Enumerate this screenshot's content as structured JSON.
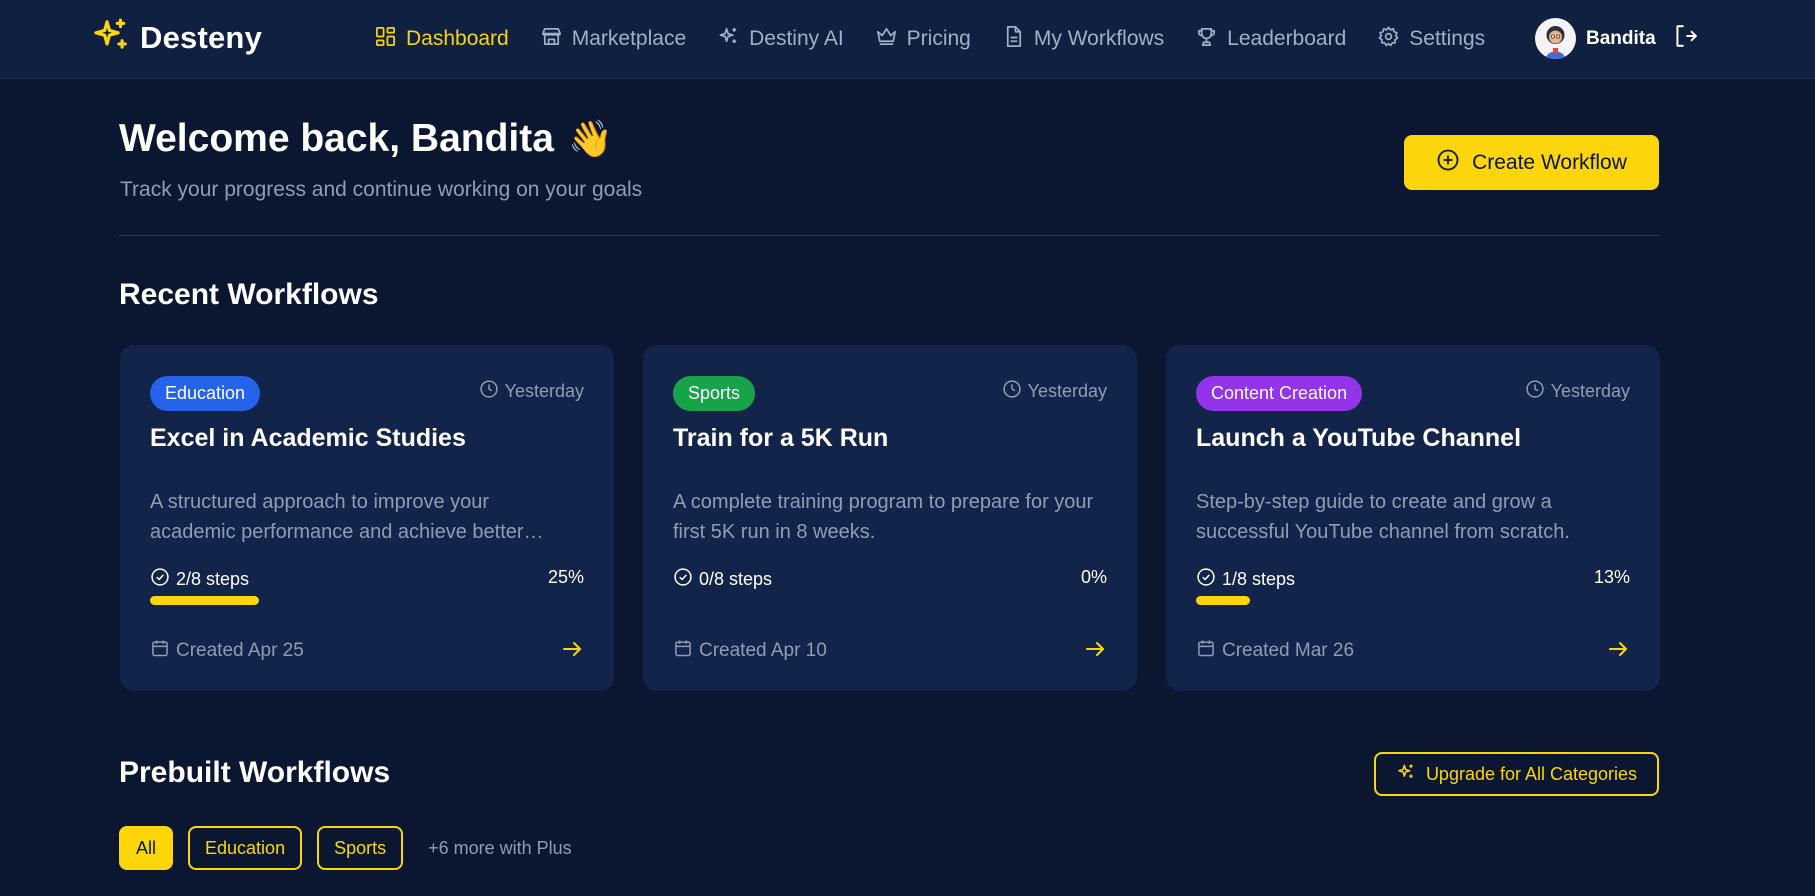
{
  "brand": {
    "name": "Desteny",
    "accent": "#fcd60a"
  },
  "nav": {
    "items": [
      {
        "label": "Dashboard",
        "icon": "grid-icon",
        "active": true
      },
      {
        "label": "Marketplace",
        "icon": "store-icon"
      },
      {
        "label": "Destiny AI",
        "icon": "sparkles-icon"
      },
      {
        "label": "Pricing",
        "icon": "crown-icon"
      },
      {
        "label": "My Workflows",
        "icon": "document-icon"
      },
      {
        "label": "Leaderboard",
        "icon": "trophy-icon"
      },
      {
        "label": "Settings",
        "icon": "gear-icon"
      }
    ],
    "user": {
      "name": "Bandita"
    }
  },
  "welcome": {
    "title": "Welcome back, Bandita",
    "emoji": "👋",
    "subtitle": "Track your progress and continue working on your goals",
    "create_button": "Create Workflow"
  },
  "recent": {
    "title": "Recent Workflows",
    "cards": [
      {
        "category": "Education",
        "category_color": "#2563eb",
        "time": "Yesterday",
        "title": "Excel in Academic Studies",
        "description": "A structured approach to improve your academic performance and achieve better grades.",
        "steps": "2/8 steps",
        "percent_label": "25%",
        "progress": 0.25,
        "created": "Created Apr 25"
      },
      {
        "category": "Sports",
        "category_color": "#16a34a",
        "time": "Yesterday",
        "title": "Train for a 5K Run",
        "description": "A complete training program to prepare for your first 5K run in 8 weeks.",
        "steps": "0/8 steps",
        "percent_label": "0%",
        "progress": 0,
        "created": "Created Apr 10"
      },
      {
        "category": "Content Creation",
        "category_color": "#9333ea",
        "time": "Yesterday",
        "title": "Launch a YouTube Channel",
        "description": "Step-by-step guide to create and grow a successful YouTube channel from scratch.",
        "steps": "1/8 steps",
        "percent_label": "13%",
        "progress": 0.125,
        "created": "Created Mar 26"
      }
    ]
  },
  "prebuilt": {
    "title": "Prebuilt Workflows",
    "upgrade_button": "Upgrade for All Categories",
    "filters": [
      "All",
      "Education",
      "Sports"
    ],
    "more_text": "+6 more with Plus"
  }
}
